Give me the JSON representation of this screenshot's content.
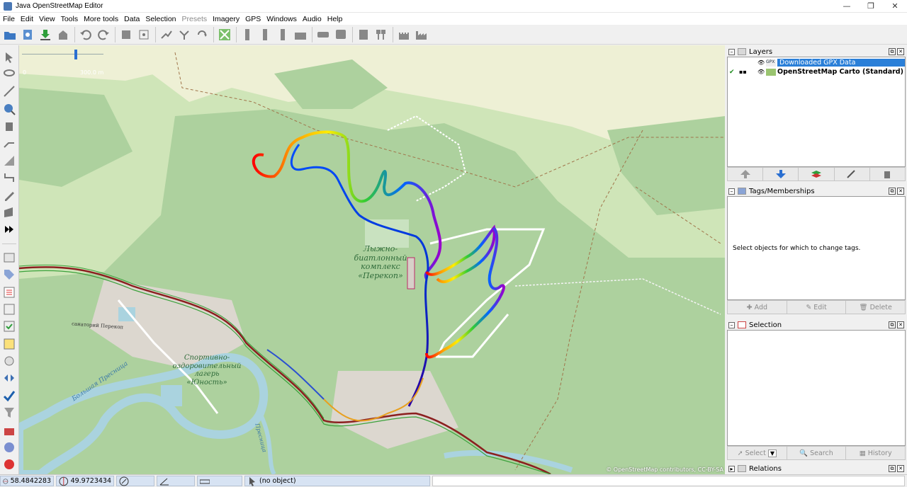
{
  "window": {
    "title": "Java OpenStreetMap Editor",
    "controls": [
      "—",
      "❐",
      "✕"
    ]
  },
  "menu": [
    {
      "label": "File",
      "enabled": true
    },
    {
      "label": "Edit",
      "enabled": true
    },
    {
      "label": "View",
      "enabled": true
    },
    {
      "label": "Tools",
      "enabled": true
    },
    {
      "label": "More tools",
      "enabled": true
    },
    {
      "label": "Data",
      "enabled": true
    },
    {
      "label": "Selection",
      "enabled": true
    },
    {
      "label": "Presets",
      "enabled": false
    },
    {
      "label": "Imagery",
      "enabled": true
    },
    {
      "label": "GPS",
      "enabled": true
    },
    {
      "label": "Windows",
      "enabled": true
    },
    {
      "label": "Audio",
      "enabled": true
    },
    {
      "label": "Help",
      "enabled": true
    }
  ],
  "map": {
    "scale": {
      "min_label": "0",
      "max_label": "300.0 m"
    },
    "labels": {
      "complex": "Лыжно-\nбиатлонный\nкомплекс\n«Перекоп»",
      "camp": "Спортивно-\nоздоровительный\nлагерь\n«Юность»",
      "sanatorium": "санаторий Перекоп",
      "river": "Большая Пресница",
      "river2": "Пресница"
    },
    "attribution": "© OpenStreetMap contributors, CC-BY-SA",
    "colors": {
      "base": "#cfe5b8",
      "forest": "#add19e",
      "field": "#eef0d5",
      "water": "#aad3df",
      "road": "#ffffff"
    }
  },
  "layers_panel": {
    "title": "Layers",
    "layers": [
      {
        "name": "Downloaded GPX Data",
        "selected": true,
        "icon_text": "GPX"
      },
      {
        "name": "OpenStreetMap Carto (Standard)",
        "selected": false,
        "active": true
      }
    ],
    "buttons": [
      "move-up",
      "move-down",
      "merge",
      "activate",
      "delete"
    ]
  },
  "tags_panel": {
    "title": "Tags/Memberships",
    "empty_text": "Select objects for which to change tags.",
    "buttons": [
      "Add",
      "Edit",
      "Delete"
    ]
  },
  "selection_panel": {
    "title": "Selection",
    "buttons": [
      "Select",
      "Search",
      "History"
    ]
  },
  "relations_panel": {
    "title": "Relations"
  },
  "status": {
    "lat": "58.4842283",
    "lon": "49.9723434",
    "object": "(no object)"
  }
}
